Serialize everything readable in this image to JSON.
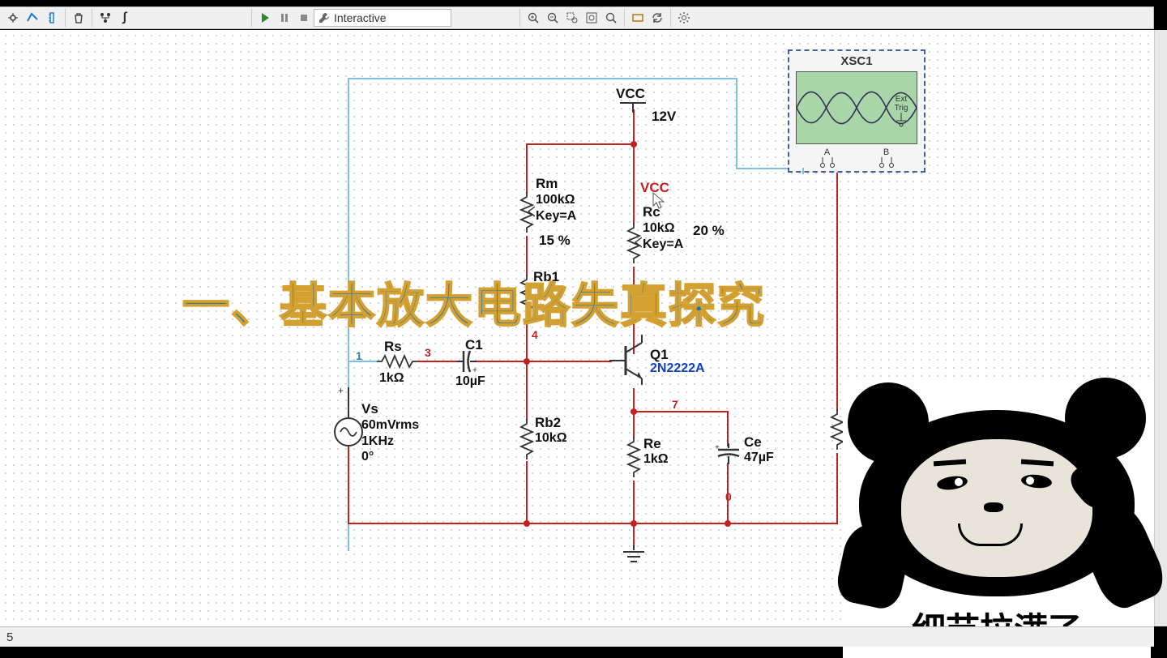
{
  "toolbar": {
    "mode_label": "Interactive"
  },
  "statusbar": {
    "text": "5"
  },
  "title_overlay": "一、基本放大电路失真探究",
  "meme": {
    "caption": "细节拉满了"
  },
  "scope": {
    "name": "XSC1",
    "ext_label": "Ext Trig",
    "port_a": "A",
    "port_b": "B"
  },
  "circuit": {
    "vcc": {
      "label": "VCC",
      "value": "12V"
    },
    "vcc_net": "VCC",
    "nodes": {
      "n1": "1",
      "n3": "3",
      "n4": "4",
      "n7": "7",
      "n0": "0"
    },
    "Rm": {
      "name": "Rm",
      "value": "100kΩ",
      "key": "Key=A",
      "percent": "15 %"
    },
    "Rc": {
      "name": "Rc",
      "value": "10kΩ",
      "key": "Key=A",
      "percent": "20 %"
    },
    "Rb1": {
      "name": "Rb1"
    },
    "Rs": {
      "name": "Rs",
      "value": "1kΩ"
    },
    "C1": {
      "name": "C1",
      "value": "10µF"
    },
    "Q1": {
      "name": "Q1",
      "model": "2N2222A"
    },
    "Rb2": {
      "name": "Rb2",
      "value": "10kΩ"
    },
    "Re": {
      "name": "Re",
      "value": "1kΩ"
    },
    "Ce": {
      "name": "Ce",
      "value": "47µF"
    },
    "Vs": {
      "name": "Vs",
      "vrms": "60mVrms",
      "freq": "1KHz",
      "phase": "0°"
    }
  }
}
